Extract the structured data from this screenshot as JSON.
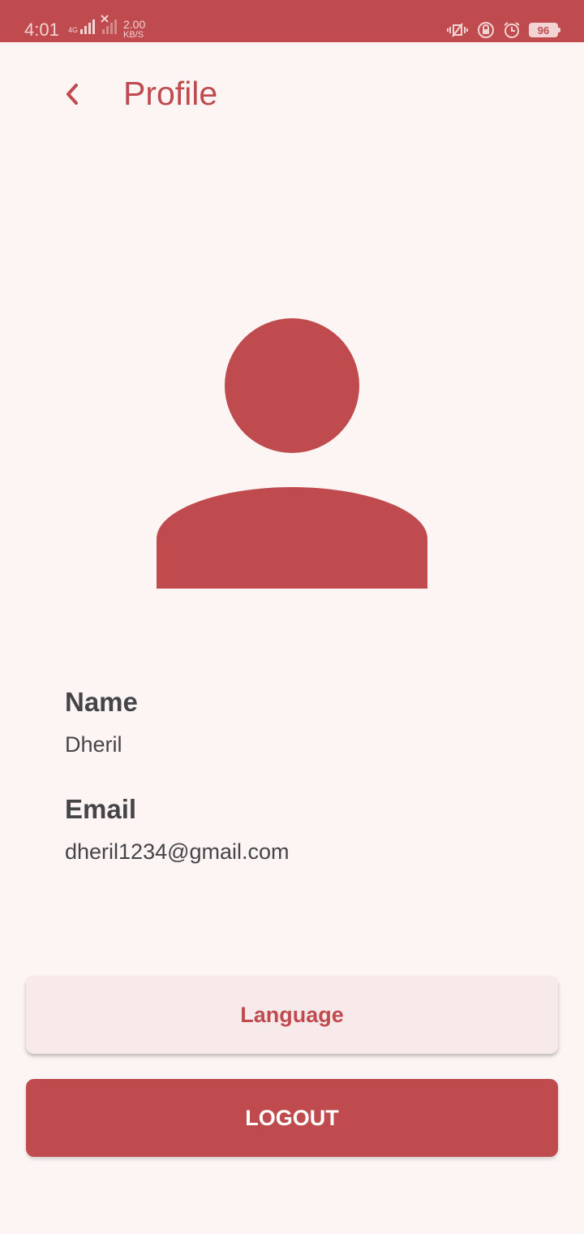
{
  "status_bar": {
    "time": "4:01",
    "network_type": "4G",
    "speed_value": "2.00",
    "speed_unit": "KB/S",
    "battery": "96",
    "icons": [
      "signal-icon",
      "signal-off-icon",
      "vibrate-icon",
      "rotation-lock-icon",
      "alarm-icon",
      "battery-icon"
    ]
  },
  "header": {
    "title": "Profile",
    "back_icon": "chevron-left-icon"
  },
  "avatar": {
    "icon": "person-icon",
    "color": "#bf4b4e"
  },
  "profile": {
    "name_label": "Name",
    "name_value": "Dheril",
    "email_label": "Email",
    "email_value": "dheril1234@gmail.com"
  },
  "actions": {
    "language_label": "Language",
    "logout_label": "LOGOUT"
  },
  "colors": {
    "accent": "#bf4b4e",
    "background": "#fdf5f4",
    "text": "#444449"
  }
}
